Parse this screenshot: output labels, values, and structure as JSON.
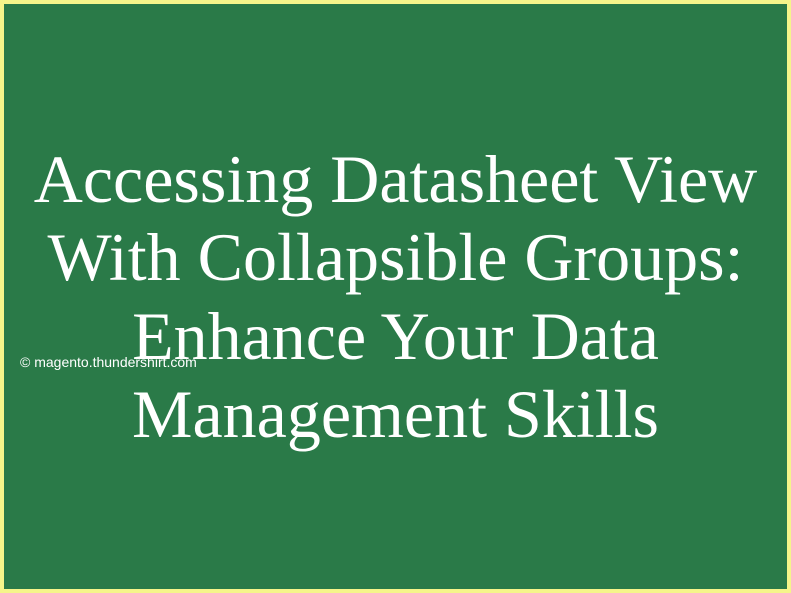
{
  "title": "Accessing Datasheet View With Collapsible Groups: Enhance Your Data Management Skills",
  "watermark": "© magento.thundershirt.com",
  "colors": {
    "background": "#2a7a48",
    "border": "#f5f58a",
    "text": "#ffffff"
  }
}
